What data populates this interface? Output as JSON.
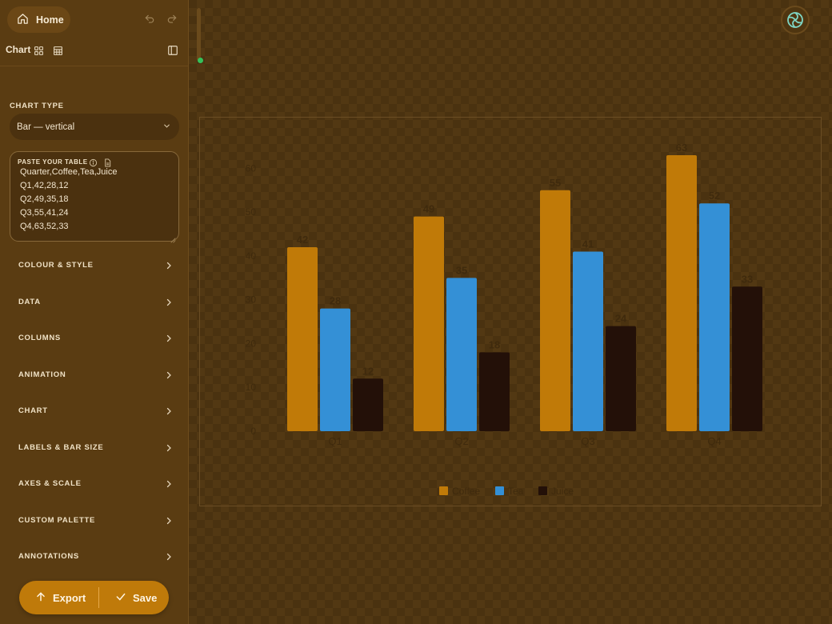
{
  "topbar": {
    "home_label": "Home"
  },
  "modebar": {
    "mode_label": "Chart"
  },
  "chart_type": {
    "title": "CHART TYPE",
    "selected": "Bar — vertical"
  },
  "paste": {
    "label": "PASTE YOUR TABLE",
    "lines": [
      "Quarter,Coffee,Tea,Juice",
      "Q1,42,28,12",
      "Q2,49,35,18",
      "Q3,55,41,24",
      "Q4,63,52,33"
    ]
  },
  "accordion": [
    "COLOUR & STYLE",
    "DATA",
    "COLUMNS",
    "ANIMATION",
    "CHART",
    "LABELS & BAR SIZE",
    "AXES & SCALE",
    "CUSTOM PALETTE",
    "ANNOTATIONS"
  ],
  "actions": {
    "export_label": "Export",
    "save_label": "Save"
  },
  "chart_data": {
    "type": "bar",
    "categories": [
      "Q1",
      "Q2",
      "Q3",
      "Q4"
    ],
    "series": [
      {
        "name": "Coffee",
        "values": [
          42,
          49,
          55,
          63
        ],
        "color": "#c07a08"
      },
      {
        "name": "Tea",
        "values": [
          28,
          35,
          41,
          52
        ],
        "color": "#3490d6"
      },
      {
        "name": "Juice",
        "values": [
          12,
          18,
          24,
          33
        ],
        "color": "#231008"
      }
    ],
    "yticks": [
      0,
      10,
      20,
      30,
      40,
      50,
      60
    ],
    "ylim": [
      0,
      63
    ],
    "grid": false,
    "legend": "bottom-center",
    "data_labels": true
  }
}
